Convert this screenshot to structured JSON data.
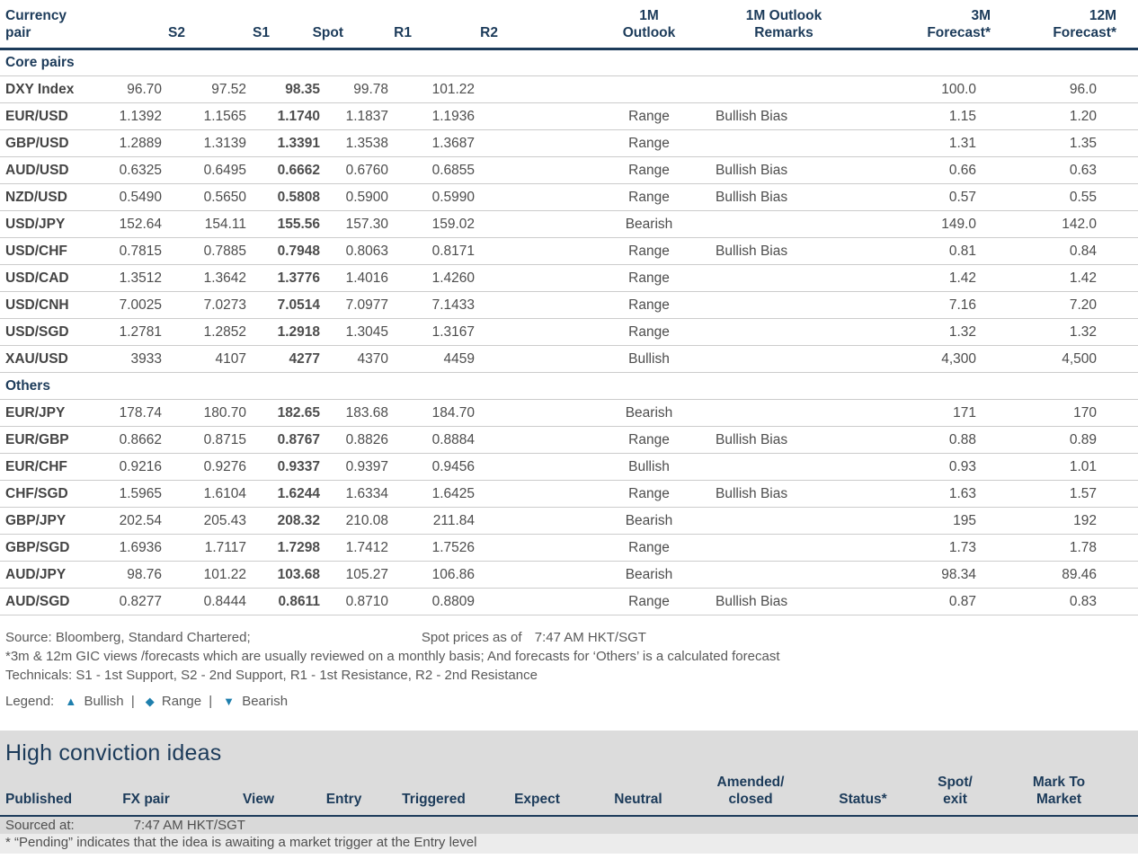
{
  "colors": {
    "navy": "#1c3b5a",
    "amber": "#f2a202",
    "red": "#ed1b2e",
    "teal": "#009488",
    "legend_blue": "#1e7fad",
    "band_gray": "#dcdcdc"
  },
  "fx_table": {
    "headers": [
      {
        "line1": "Currency",
        "line2": "pair",
        "key": "pair"
      },
      {
        "line1": "",
        "line2": "S2",
        "key": "s2"
      },
      {
        "line1": "",
        "line2": "S1",
        "key": "s1"
      },
      {
        "line1": "",
        "line2": "Spot",
        "key": "spot"
      },
      {
        "line1": "",
        "line2": "R1",
        "key": "r1"
      },
      {
        "line1": "",
        "line2": "R2",
        "key": "r2"
      },
      {
        "line1": "1M",
        "line2": "Outlook",
        "key": "outlook"
      },
      {
        "line1": "1M Outlook",
        "line2": "Remarks",
        "key": "remarks"
      },
      {
        "line1": "3M",
        "line2": "Forecast*",
        "key": "f3m"
      },
      {
        "line1": "12M",
        "line2": "Forecast*",
        "key": "f12m"
      }
    ],
    "sections": [
      {
        "label": "Core pairs",
        "rows": [
          {
            "pair": "DXY Index",
            "s2": "96.70",
            "s1": "97.52",
            "spot": "98.35",
            "r1": "99.78",
            "r2": "101.22",
            "outlook": "",
            "outlook_type": "",
            "remarks": "",
            "f3m": "100.0",
            "f12m": "96.0"
          },
          {
            "pair": "EUR/USD",
            "s2": "1.1392",
            "s1": "1.1565",
            "spot": "1.1740",
            "r1": "1.1837",
            "r2": "1.1936",
            "outlook": "Range",
            "outlook_type": "range",
            "remarks": "Bullish Bias",
            "f3m": "1.15",
            "f12m": "1.20"
          },
          {
            "pair": "GBP/USD",
            "s2": "1.2889",
            "s1": "1.3139",
            "spot": "1.3391",
            "r1": "1.3538",
            "r2": "1.3687",
            "outlook": "Range",
            "outlook_type": "range",
            "remarks": "",
            "f3m": "1.31",
            "f12m": "1.35"
          },
          {
            "pair": "AUD/USD",
            "s2": "0.6325",
            "s1": "0.6495",
            "spot": "0.6662",
            "r1": "0.6760",
            "r2": "0.6855",
            "outlook": "Range",
            "outlook_type": "range",
            "remarks": "Bullish Bias",
            "f3m": "0.66",
            "f12m": "0.63"
          },
          {
            "pair": "NZD/USD",
            "s2": "0.5490",
            "s1": "0.5650",
            "spot": "0.5808",
            "r1": "0.5900",
            "r2": "0.5990",
            "outlook": "Range",
            "outlook_type": "range",
            "remarks": "Bullish Bias",
            "f3m": "0.57",
            "f12m": "0.55"
          },
          {
            "pair": "USD/JPY",
            "s2": "152.64",
            "s1": "154.11",
            "spot": "155.56",
            "r1": "157.30",
            "r2": "159.02",
            "outlook": "Bearish",
            "outlook_type": "bearish",
            "remarks": "",
            "f3m": "149.0",
            "f12m": "142.0"
          },
          {
            "pair": "USD/CHF",
            "s2": "0.7815",
            "s1": "0.7885",
            "spot": "0.7948",
            "r1": "0.8063",
            "r2": "0.8171",
            "outlook": "Range",
            "outlook_type": "range",
            "remarks": "Bullish Bias",
            "f3m": "0.81",
            "f12m": "0.84"
          },
          {
            "pair": "USD/CAD",
            "s2": "1.3512",
            "s1": "1.3642",
            "spot": "1.3776",
            "r1": "1.4016",
            "r2": "1.4260",
            "outlook": "Range",
            "outlook_type": "range",
            "remarks": "",
            "f3m": "1.42",
            "f12m": "1.42"
          },
          {
            "pair": "USD/CNH",
            "s2": "7.0025",
            "s1": "7.0273",
            "spot": "7.0514",
            "r1": "7.0977",
            "r2": "7.1433",
            "outlook": "Range",
            "outlook_type": "range",
            "remarks": "",
            "f3m": "7.16",
            "f12m": "7.20"
          },
          {
            "pair": "USD/SGD",
            "s2": "1.2781",
            "s1": "1.2852",
            "spot": "1.2918",
            "r1": "1.3045",
            "r2": "1.3167",
            "outlook": "Range",
            "outlook_type": "range",
            "remarks": "",
            "f3m": "1.32",
            "f12m": "1.32"
          },
          {
            "pair": "XAU/USD",
            "s2": "3933",
            "s1": "4107",
            "spot": "4277",
            "r1": "4370",
            "r2": "4459",
            "outlook": "Bullish",
            "outlook_type": "bullish",
            "remarks": "",
            "f3m": "4,300",
            "f12m": "4,500"
          }
        ]
      },
      {
        "label": "Others",
        "rows": [
          {
            "pair": "EUR/JPY",
            "s2": "178.74",
            "s1": "180.70",
            "spot": "182.65",
            "r1": "183.68",
            "r2": "184.70",
            "outlook": "Bearish",
            "outlook_type": "bearish",
            "remarks": "",
            "f3m": "171",
            "f12m": "170"
          },
          {
            "pair": "EUR/GBP",
            "s2": "0.8662",
            "s1": "0.8715",
            "spot": "0.8767",
            "r1": "0.8826",
            "r2": "0.8884",
            "outlook": "Range",
            "outlook_type": "range",
            "remarks": "Bullish Bias",
            "f3m": "0.88",
            "f12m": "0.89"
          },
          {
            "pair": "EUR/CHF",
            "s2": "0.9216",
            "s1": "0.9276",
            "spot": "0.9337",
            "r1": "0.9397",
            "r2": "0.9456",
            "outlook": "Bullish",
            "outlook_type": "bullish",
            "remarks": "",
            "f3m": "0.93",
            "f12m": "1.01"
          },
          {
            "pair": "CHF/SGD",
            "s2": "1.5965",
            "s1": "1.6104",
            "spot": "1.6244",
            "r1": "1.6334",
            "r2": "1.6425",
            "outlook": "Range",
            "outlook_type": "range",
            "remarks": "Bullish Bias",
            "f3m": "1.63",
            "f12m": "1.57"
          },
          {
            "pair": "GBP/JPY",
            "s2": "202.54",
            "s1": "205.43",
            "spot": "208.32",
            "r1": "210.08",
            "r2": "211.84",
            "outlook": "Bearish",
            "outlook_type": "bearish",
            "remarks": "",
            "f3m": "195",
            "f12m": "192"
          },
          {
            "pair": "GBP/SGD",
            "s2": "1.6936",
            "s1": "1.7117",
            "spot": "1.7298",
            "r1": "1.7412",
            "r2": "1.7526",
            "outlook": "Range",
            "outlook_type": "range",
            "remarks": "",
            "f3m": "1.73",
            "f12m": "1.78"
          },
          {
            "pair": "AUD/JPY",
            "s2": "98.76",
            "s1": "101.22",
            "spot": "103.68",
            "r1": "105.27",
            "r2": "106.86",
            "outlook": "Bearish",
            "outlook_type": "bearish",
            "remarks": "",
            "f3m": "98.34",
            "f12m": "89.46"
          },
          {
            "pair": "AUD/SGD",
            "s2": "0.8277",
            "s1": "0.8444",
            "spot": "0.8611",
            "r1": "0.8710",
            "r2": "0.8809",
            "outlook": "Range",
            "outlook_type": "range",
            "remarks": "Bullish Bias",
            "f3m": "0.87",
            "f12m": "0.83"
          }
        ]
      }
    ]
  },
  "footnotes": {
    "source": "Source: Bloomberg, Standard Chartered;",
    "spot_label": "Spot prices as of",
    "spot_time": "7:47 AM HKT/SGT",
    "note_forecast": "*3m & 12m GIC views /forecasts which are usually reviewed on a monthly basis; And forecasts for ‘Others’ is a calculated forecast",
    "note_technicals": "Technicals: S1 - 1st Support, S2 - 2nd Support, R1 - 1st Resistance, R2 - 2nd Resistance"
  },
  "legend": {
    "label": "Legend:",
    "items": [
      {
        "icon": "▲",
        "icon_name": "bullish-triangle-up-icon",
        "label": "Bullish"
      },
      {
        "icon": "◆",
        "icon_name": "range-diamond-icon",
        "label": "Range"
      },
      {
        "icon": "▼",
        "icon_name": "bearish-triangle-down-icon",
        "label": "Bearish"
      }
    ],
    "separator": "|"
  },
  "high_conviction": {
    "title": "High conviction ideas",
    "headers": [
      {
        "line1": "",
        "line2": "Published",
        "key": "published"
      },
      {
        "line1": "",
        "line2": "FX pair",
        "key": "fxpair"
      },
      {
        "line1": "",
        "line2": "View",
        "key": "view"
      },
      {
        "line1": "",
        "line2": "Entry",
        "key": "entry"
      },
      {
        "line1": "",
        "line2": "Triggered",
        "key": "triggered"
      },
      {
        "line1": "",
        "line2": "Expect",
        "key": "expect"
      },
      {
        "line1": "",
        "line2": "Neutral",
        "key": "neutral"
      },
      {
        "line1": "Amended/",
        "line2": "closed",
        "key": "amended"
      },
      {
        "line1": "",
        "line2": "Status*",
        "key": "status"
      },
      {
        "line1": "Spot/",
        "line2": "exit",
        "key": "spotexit"
      },
      {
        "line1": "Mark To",
        "line2": "Market",
        "key": "mtm"
      }
    ],
    "sourced_label": "Sourced at:",
    "sourced_time": "7:47 AM HKT/SGT",
    "pending_note": "* “Pending” indicates that the idea is awaiting a market trigger at the Entry level"
  }
}
